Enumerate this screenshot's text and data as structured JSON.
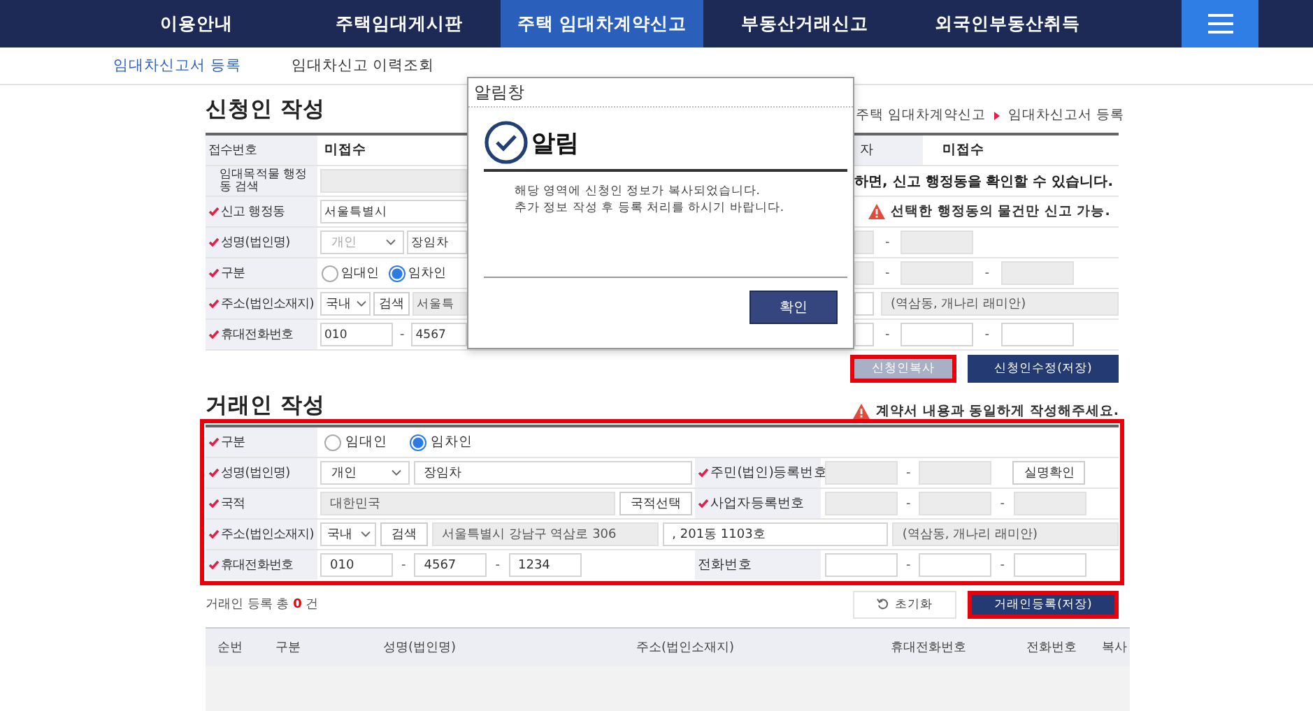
{
  "nav": {
    "items": [
      {
        "label": "이용안내",
        "selected": false
      },
      {
        "label": "주택임대게시판",
        "selected": false
      },
      {
        "label": "주택 임대차계약신고",
        "selected": true
      },
      {
        "label": "부동산거래신고",
        "selected": false
      },
      {
        "label": "외국인부동산취득",
        "selected": false
      }
    ]
  },
  "subnav": [
    {
      "label": "임대차신고서 등록",
      "selected": true
    },
    {
      "label": "임대차신고 이력조회",
      "selected": false
    }
  ],
  "applicant": {
    "title": "신청인 작성",
    "breadcrumb": [
      "주택 임대차계약신고",
      "임대차신고서 등록"
    ],
    "rows": [
      {
        "label": "접수번호",
        "required": false,
        "left": [
          {
            "kind": "text",
            "text": "미접수"
          }
        ],
        "right": [
          {
            "kind": "label",
            "text": "자"
          },
          {
            "kind": "text",
            "text": "미접수"
          }
        ]
      },
      {
        "label": "임대목적물 행정동 검색",
        "required": false,
        "left": [
          {
            "kind": "long_input",
            "disabled": true
          }
        ],
        "right": [
          {
            "kind": "note",
            "text": "하면, 신고 행정동을 확인할 수 있습니다."
          }
        ]
      },
      {
        "label": "신고 행정동",
        "required": true,
        "left": [
          {
            "kind": "long_input",
            "value": "서울특별시",
            "disabled": false
          }
        ],
        "right": [
          {
            "kind": "warning",
            "text": "선택한 행정동의 물건만 신고 가능."
          }
        ]
      },
      {
        "label": "성명(법인명)",
        "required": true,
        "left": [
          {
            "kind": "select",
            "value": "개인",
            "disabled": true
          },
          {
            "kind": "long_input",
            "value": "장임차",
            "disabled": false
          }
        ],
        "right": [
          {
            "kind": "input",
            "disabled": true
          },
          {
            "kind": "dash",
            "text": "-"
          },
          {
            "kind": "input",
            "disabled": true
          }
        ]
      },
      {
        "label": "구분",
        "required": true,
        "left": [
          {
            "kind": "radio",
            "label": "임대인",
            "selected": false
          },
          {
            "kind": "radio",
            "label": "임차인",
            "selected": true
          }
        ],
        "right": [
          {
            "kind": "input",
            "disabled": true
          },
          {
            "kind": "dash",
            "text": "-"
          },
          {
            "kind": "input",
            "disabled": true
          },
          {
            "kind": "dash",
            "text": "-"
          },
          {
            "kind": "input",
            "disabled": true
          }
        ]
      },
      {
        "label": "주소(법인소재지)",
        "required": true,
        "left": [
          {
            "kind": "select",
            "value": "국내",
            "disabled": false
          },
          {
            "kind": "button",
            "label": "검색"
          },
          {
            "kind": "long_input",
            "value": "서울특",
            "disabled": true
          }
        ],
        "right": [
          {
            "kind": "input",
            "disabled": false
          },
          {
            "kind": "long_input",
            "value": "(역삼동, 개나리 래미안)",
            "disabled": true
          }
        ]
      },
      {
        "label": "휴대전화번호",
        "required": true,
        "left": [
          {
            "kind": "input",
            "value": "010",
            "disabled": false
          },
          {
            "kind": "dash",
            "text": "-"
          },
          {
            "kind": "long_input",
            "value": "4567",
            "disabled": false
          }
        ],
        "right": [
          {
            "kind": "input",
            "disabled": false
          },
          {
            "kind": "dash",
            "text": "-"
          },
          {
            "kind": "input",
            "disabled": false
          },
          {
            "kind": "dash",
            "text": "-"
          },
          {
            "kind": "input",
            "disabled": false
          }
        ]
      }
    ],
    "buttons": [
      {
        "label": "신청인복사",
        "kind": "secondary",
        "highlighted": true
      },
      {
        "label": "신청인수정(저장)",
        "kind": "primary",
        "highlighted": false
      }
    ]
  },
  "party": {
    "title": "거래인 작성",
    "warning": "계약서 내용과 동일하게 작성해주세요.",
    "highlighted": true,
    "rows": [
      {
        "label": "구분",
        "required": true,
        "left": [
          {
            "kind": "radio",
            "label": "임대인",
            "selected": false
          },
          {
            "kind": "radio",
            "label": "임차인",
            "selected": true
          }
        ]
      },
      {
        "label": "성명(법인명)",
        "required": true,
        "left": [
          {
            "kind": "select",
            "value": "개인",
            "disabled": false
          },
          {
            "kind": "long_input",
            "value": "장임차",
            "disabled": false
          }
        ],
        "label2": "주민(법인)등록번호",
        "required2": true,
        "right": [
          {
            "kind": "input",
            "disabled": true
          },
          {
            "kind": "dash",
            "text": "-"
          },
          {
            "kind": "input",
            "disabled": true
          },
          {
            "kind": "button",
            "label": "실명확인"
          }
        ]
      },
      {
        "label": "국적",
        "required": true,
        "left": [
          {
            "kind": "long_input",
            "value": "대한민국",
            "disabled": true
          },
          {
            "kind": "button",
            "label": "국적선택"
          }
        ],
        "label2": "사업자등록번호",
        "required2": true,
        "right": [
          {
            "kind": "input",
            "disabled": true
          },
          {
            "kind": "dash",
            "text": "-"
          },
          {
            "kind": "input",
            "disabled": true
          },
          {
            "kind": "dash",
            "text": "-"
          },
          {
            "kind": "input",
            "disabled": true
          }
        ]
      },
      {
        "label": "주소(법인소재지)",
        "required": true,
        "left": [
          {
            "kind": "select",
            "value": "국내",
            "disabled": false
          },
          {
            "kind": "button",
            "label": "검색"
          },
          {
            "kind": "long_input",
            "value": "서울특별시 강남구 역삼로 306",
            "disabled": true
          },
          {
            "kind": "long_input",
            "value": ", 201동 1103호",
            "disabled": false
          },
          {
            "kind": "long_input",
            "value": "(역삼동, 개나리 래미안)",
            "disabled": true
          }
        ]
      },
      {
        "label": "휴대전화번호",
        "required": true,
        "left": [
          {
            "kind": "input",
            "value": "010",
            "disabled": false
          },
          {
            "kind": "dash",
            "text": "-"
          },
          {
            "kind": "input",
            "value": "4567",
            "disabled": false
          },
          {
            "kind": "dash",
            "text": "-"
          },
          {
            "kind": "input",
            "value": "1234",
            "disabled": false
          }
        ],
        "label2": "전화번호",
        "required2": false,
        "right": [
          {
            "kind": "input",
            "disabled": false
          },
          {
            "kind": "dash",
            "text": "-"
          },
          {
            "kind": "input",
            "disabled": false
          },
          {
            "kind": "dash",
            "text": "-"
          },
          {
            "kind": "input",
            "disabled": false
          }
        ]
      }
    ],
    "count_text": "거래인 등록 총 **0** 건",
    "buttons": [
      {
        "label": "초기화",
        "kind": "reset",
        "highlighted": false
      },
      {
        "label": "거래인등록(저장)",
        "kind": "primary",
        "highlighted": true
      }
    ]
  },
  "table": {
    "columns": [
      "순번",
      "구분",
      "성명(법인명)",
      "주소(법인소재지)",
      "휴대전화번호",
      "전화번호",
      "복사"
    ]
  },
  "dialog": {
    "window_title": "알림창",
    "heading": "알림",
    "message": [
      "해당 영역에 신청인 정보가 복사되었습니다.",
      "추가 정보 작성 후 등록 처리를 하시기 바랍니다."
    ],
    "button": "확인"
  }
}
